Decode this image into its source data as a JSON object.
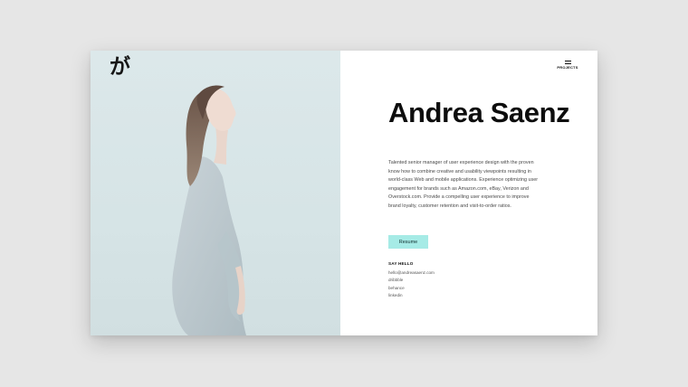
{
  "logo": {
    "text": "が"
  },
  "menu": {
    "label": "PROJECTS",
    "icon": "hamburger-icon"
  },
  "profile": {
    "name": "Andrea Saenz",
    "bio": "Talented senior manager of user experience design with the proven know how to combine creative and usability viewpoints resulting in world-class Web and mobile applications. Experience optimizing user engagement for brands such as Amazon.com, eBay, Verizon and Overstock.com. Provide a compelling user experience to improve brand loyalty, customer retention and visit-to-order ratios."
  },
  "resume": {
    "label": "Resume"
  },
  "contact": {
    "heading": "SAY HELLO",
    "links": [
      "hello@andreasaenz.com",
      "dribbble",
      "behance",
      "linkedin"
    ]
  },
  "colors": {
    "accent": "#a6ebe6",
    "photo_bg": "#d6e4e6",
    "text": "#0d0d0d"
  }
}
